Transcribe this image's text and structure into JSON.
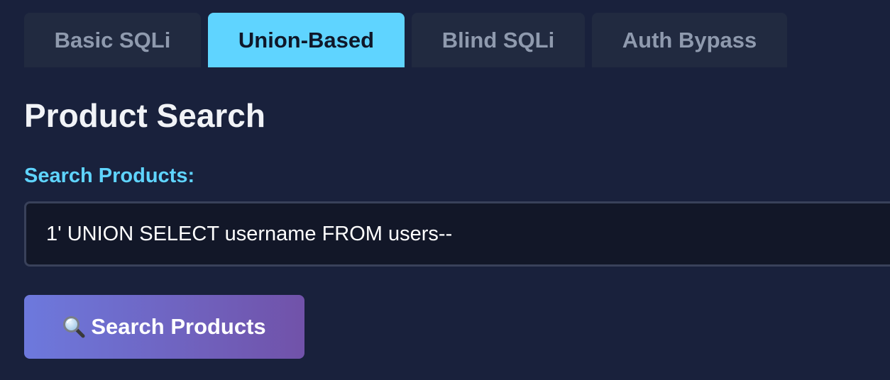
{
  "tabs": [
    {
      "label": "Basic SQLi",
      "active": false
    },
    {
      "label": "Union-Based",
      "active": true
    },
    {
      "label": "Blind SQLi",
      "active": false
    },
    {
      "label": "Auth Bypass",
      "active": false
    }
  ],
  "main": {
    "title": "Product Search",
    "search_label": "Search Products:",
    "search_value": "1' UNION SELECT username FROM users--",
    "button_label": "Search Products",
    "button_icon": "magnifier-icon"
  },
  "colors": {
    "background": "#19213c",
    "accent": "#5fd4ff",
    "tab_inactive": "#212a40",
    "button_gradient_start": "#6d79dd",
    "button_gradient_end": "#7152a9"
  }
}
